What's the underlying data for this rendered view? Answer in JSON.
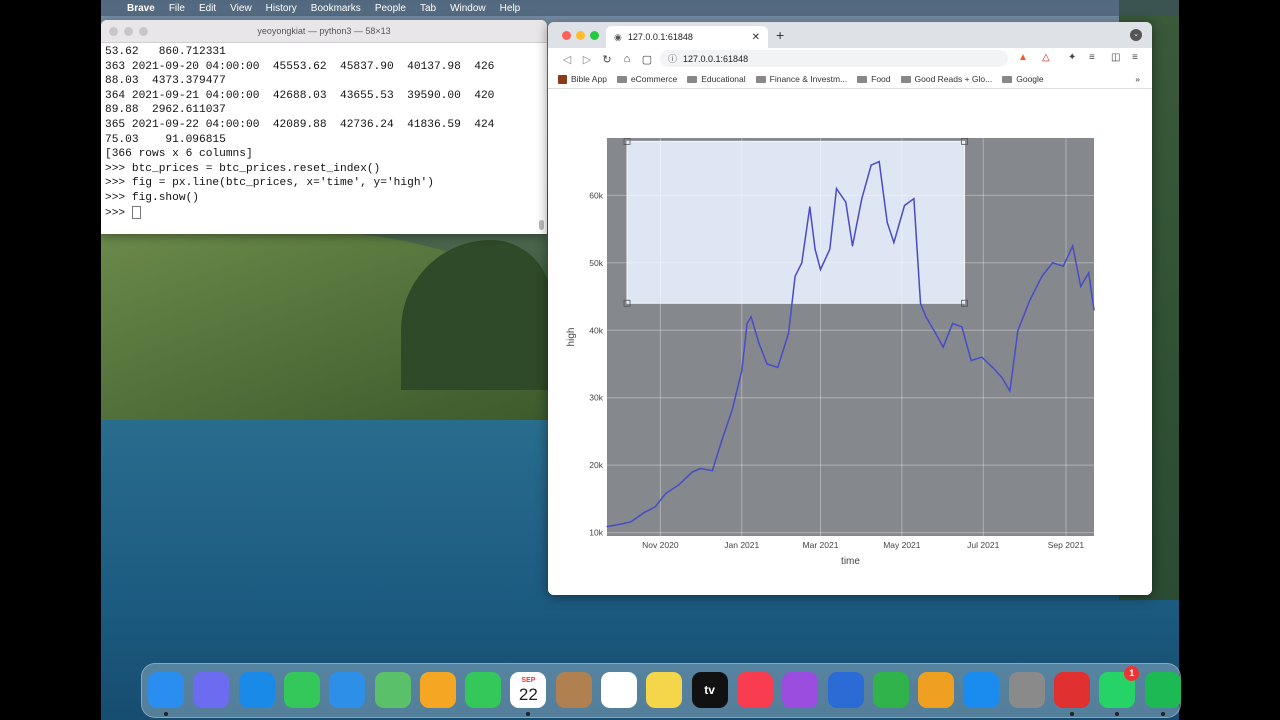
{
  "menubar": {
    "app": "Brave",
    "items": [
      "File",
      "Edit",
      "View",
      "History",
      "Bookmarks",
      "People",
      "Tab",
      "Window",
      "Help"
    ]
  },
  "terminal": {
    "title": "yeoyongkiat — python3 — 58×13",
    "lines": [
      "53.62   860.712331",
      "363 2021-09-20 04:00:00  45553.62  45837.90  40137.98  426",
      "88.03  4373.379477",
      "364 2021-09-21 04:00:00  42688.03  43655.53  39590.00  420",
      "89.88  2962.611037",
      "365 2021-09-22 04:00:00  42089.88  42736.24  41836.59  424",
      "75.03    91.096815",
      "",
      "[366 rows x 6 columns]",
      ">>> btc_prices = btc_prices.reset_index()",
      ">>> fig = px.line(btc_prices, x='time', y='high')",
      ">>> fig.show()"
    ],
    "prompt": ">>> "
  },
  "browser": {
    "tab_title": "127.0.0.1:61848",
    "url": "127.0.0.1:61848",
    "bookmarks": [
      "Bible App",
      "eCommerce",
      "Educational",
      "Finance & Investm...",
      "Food",
      "Good Reads + Glo...",
      "Google"
    ],
    "more": "»"
  },
  "chart_data": {
    "type": "line",
    "xlabel": "time",
    "ylabel": "high",
    "x_ticks": [
      "Nov 2020",
      "Jan 2021",
      "Mar 2021",
      "May 2021",
      "Jul 2021",
      "Sep 2021"
    ],
    "y_ticks": [
      "10k",
      "20k",
      "30k",
      "40k",
      "50k",
      "60k"
    ],
    "ylim": [
      9500,
      68500
    ],
    "xlim": [
      "2020-09-22",
      "2021-09-22"
    ],
    "line_color": "#4a4bc8",
    "plot_bg": "#85888c",
    "selection_box": {
      "x0": "2020-10-07",
      "x1": "2021-06-17",
      "y0": 44000,
      "y1": 68000
    },
    "series": [
      {
        "x": [
          "2020-09-22",
          "2020-10-01",
          "2020-10-10",
          "2020-10-20",
          "2020-10-28",
          "2020-11-05",
          "2020-11-15",
          "2020-11-25",
          "2020-12-01",
          "2020-12-10",
          "2020-12-17",
          "2020-12-25",
          "2021-01-01",
          "2021-01-05",
          "2021-01-08",
          "2021-01-14",
          "2021-01-20",
          "2021-01-28",
          "2021-02-05",
          "2021-02-10",
          "2021-02-15",
          "2021-02-21",
          "2021-02-25",
          "2021-03-01",
          "2021-03-08",
          "2021-03-13",
          "2021-03-20",
          "2021-03-25",
          "2021-04-01",
          "2021-04-08",
          "2021-04-14",
          "2021-04-20",
          "2021-04-25",
          "2021-05-03",
          "2021-05-10",
          "2021-05-15",
          "2021-05-19",
          "2021-05-25",
          "2021-06-01",
          "2021-06-08",
          "2021-06-15",
          "2021-06-22",
          "2021-06-30",
          "2021-07-08",
          "2021-07-15",
          "2021-07-21",
          "2021-07-27",
          "2021-08-05",
          "2021-08-14",
          "2021-08-22",
          "2021-08-30",
          "2021-09-06",
          "2021-09-12",
          "2021-09-18",
          "2021-09-22"
        ],
        "y": [
          10900,
          11200,
          11600,
          13000,
          13800,
          15800,
          17100,
          19000,
          19500,
          19200,
          23600,
          28300,
          34000,
          41000,
          42000,
          38000,
          35000,
          34500,
          39500,
          48000,
          50000,
          58300,
          52000,
          49000,
          52000,
          61000,
          59000,
          52500,
          59500,
          64500,
          65000,
          56000,
          53000,
          58500,
          59500,
          44000,
          42000,
          40000,
          37500,
          41000,
          40500,
          35500,
          36000,
          34500,
          33000,
          31000,
          40000,
          44500,
          48000,
          50000,
          49500,
          52500,
          46500,
          48500,
          43000
        ]
      }
    ]
  },
  "dock": {
    "apps": [
      "Finder",
      "Launchpad",
      "Safari",
      "Messages",
      "Mail",
      "Maps",
      "Photos",
      "FaceTime",
      "Calendar",
      "Contacts",
      "Reminders",
      "Notes",
      "TV",
      "Music",
      "Podcasts",
      "Keynote",
      "Numbers",
      "Pages",
      "App Store",
      "System Preferences",
      "Brave",
      "WhatsApp",
      "Spotify"
    ],
    "calendar_month": "SEP",
    "calendar_day": "22",
    "whatsapp_badge": "1",
    "tv_label": "tv"
  }
}
